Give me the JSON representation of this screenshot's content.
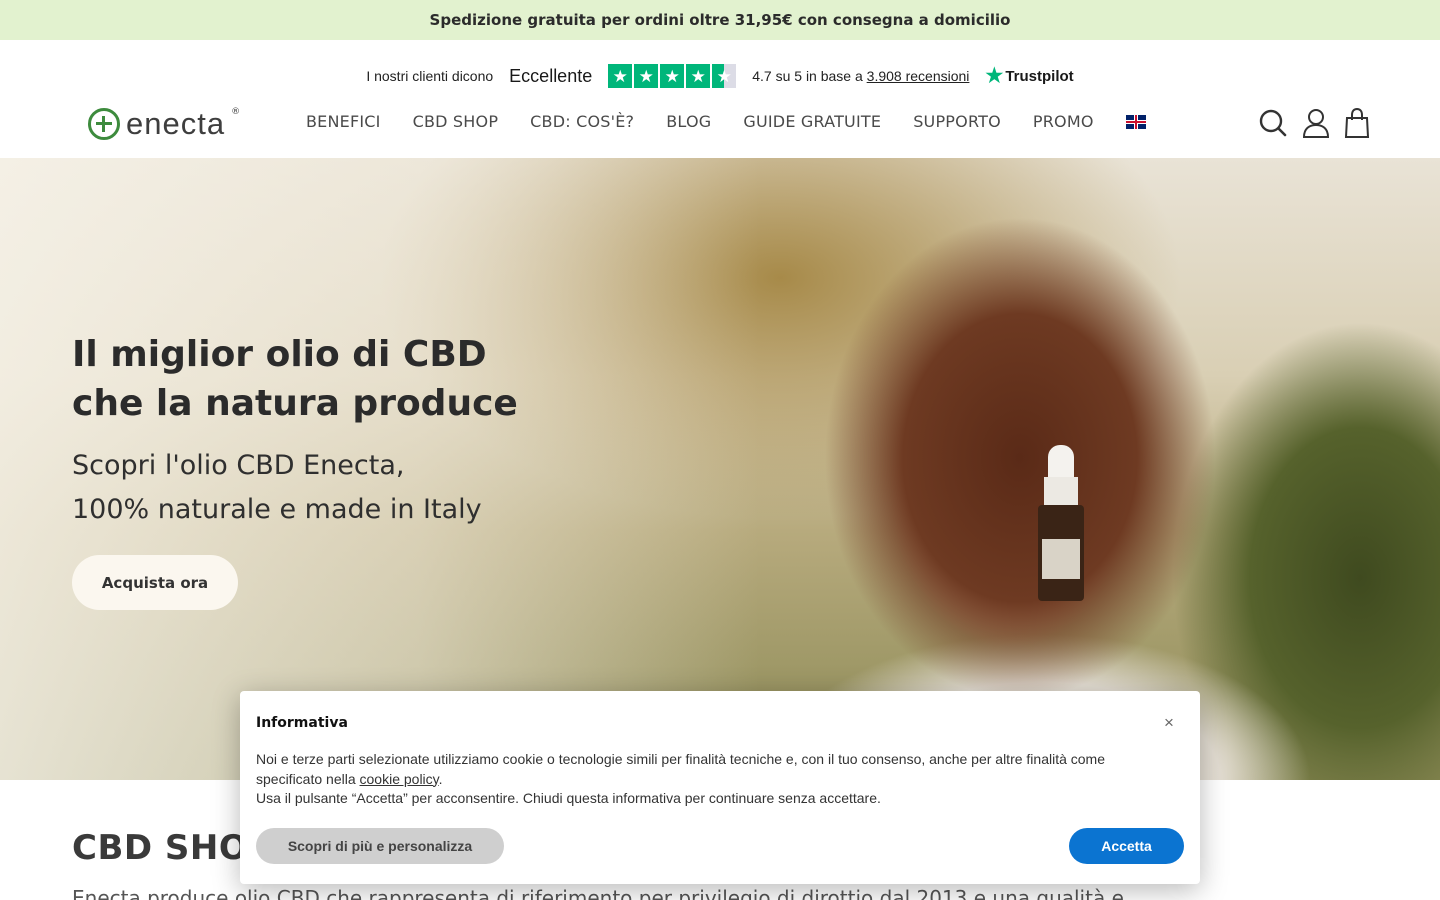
{
  "promo_bar": {
    "text": "Spedizione gratuita per ordini oltre 31,95€ con consegna a domicilio"
  },
  "trustpilot": {
    "intro": "I nostri clienti dicono",
    "rating_word": "Eccellente",
    "stars": 4.5,
    "score_prefix": "4.7 su 5 in base a ",
    "reviews_link": "3.908 recensioni",
    "brand": "Trustpilot",
    "star_color": "#00b67a"
  },
  "logo": {
    "text": "enecta",
    "reg": "®",
    "color": "#3d8b3d"
  },
  "nav": {
    "items": [
      "BENEFICI",
      "CBD SHOP",
      "CBD: COS'È?",
      "BLOG",
      "GUIDE GRATUITE",
      "SUPPORTO",
      "PROMO"
    ],
    "language_icon": "uk-flag-icon"
  },
  "header_icons": [
    "search-icon",
    "user-icon",
    "bag-icon"
  ],
  "hero": {
    "title_line1": "Il miglior olio di CBD",
    "title_line2": "che la natura produce",
    "subtitle_line1": "Scopri l'olio CBD Enecta,",
    "subtitle_line2": "100% naturale e made in Italy",
    "cta": "Acquista ora"
  },
  "section": {
    "title": "CBD SHO",
    "text": "Enecta produce olio CBD che rappresenta di riferimento per privilegio di dirottio dal 2013 e una qualità e"
  },
  "cookie": {
    "title": "Informativa",
    "close": "×",
    "text_part1": "Noi e terze parti selezionate utilizziamo cookie o tecnologie simili per finalità tecniche e, con il tuo consenso, anche per altre finalità come specificato nella ",
    "policy_link": "cookie policy",
    "text_part2": ".",
    "text_line2": "Usa il pulsante “Accetta” per acconsentire. Chiudi questa informativa per continuare senza accettare.",
    "learn_more": "Scopri di più e personalizza",
    "accept": "Accetta",
    "accept_color": "#0b74d1"
  }
}
